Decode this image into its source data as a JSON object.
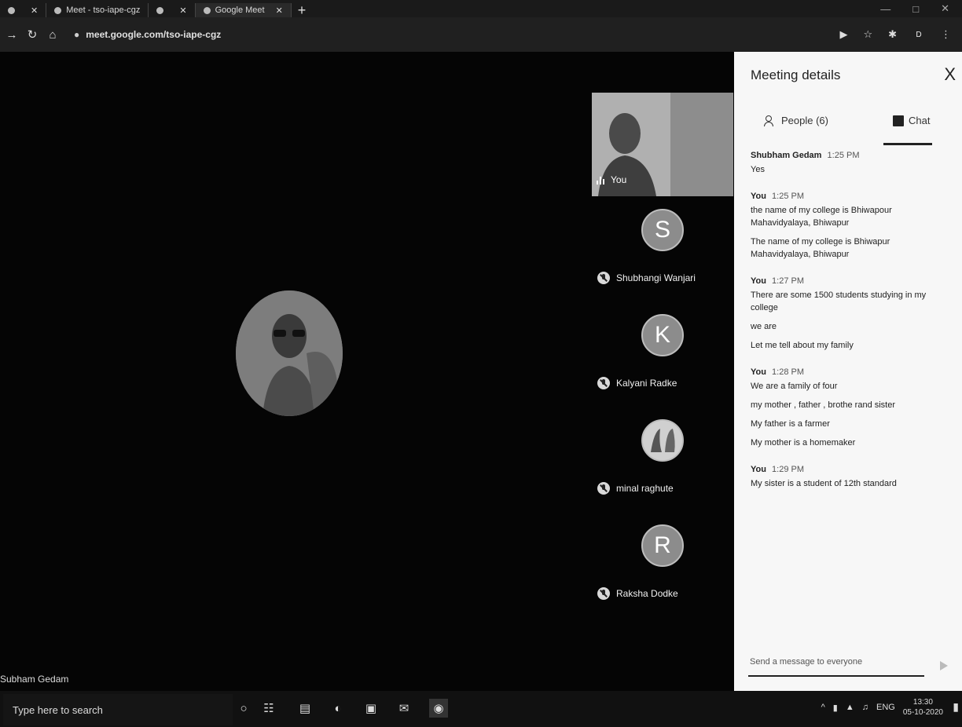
{
  "browser": {
    "tabs": [
      {
        "label": "",
        "active": false
      },
      {
        "label": "Meet - tso-iape-cgz",
        "active": false
      },
      {
        "label": "",
        "active": false
      },
      {
        "label": "Google Meet",
        "active": true
      }
    ],
    "new_tab": "+",
    "url": "meet.google.com/tso-iape-cgz",
    "profile_initial": "D"
  },
  "stage": {
    "presenter_name": "Subham Gedam",
    "self_tile_label": "You",
    "participants": [
      {
        "initial": "S",
        "name": "Shubhangi Wanjari",
        "muted": true,
        "photo": false
      },
      {
        "initial": "K",
        "name": "Kalyani Radke",
        "muted": true,
        "photo": false
      },
      {
        "initial": "",
        "name": "minal raghute",
        "muted": true,
        "photo": true
      },
      {
        "initial": "R",
        "name": "Raksha Dodke",
        "muted": true,
        "photo": false
      }
    ]
  },
  "panel": {
    "title": "Meeting details",
    "close": "X",
    "tab_people": "People (6)",
    "tab_chat": "Chat",
    "messages": [
      {
        "sender": "Shubham Gedam",
        "time": "1:25 PM",
        "lines": [
          "Yes"
        ]
      },
      {
        "sender": "You",
        "time": "1:25 PM",
        "lines": [
          "the name of my college is Bhiwapour Mahavidyalaya, Bhiwapur",
          "The name of my college is Bhiwapur Mahavidyalaya, Bhiwapur"
        ]
      },
      {
        "sender": "You",
        "time": "1:27 PM",
        "lines": [
          "There are some 1500 students studying in my college",
          "we are",
          "Let me tell about my family"
        ]
      },
      {
        "sender": "You",
        "time": "1:28 PM",
        "lines": [
          "We are  a family of four",
          "my mother , father , brothe rand sister",
          "My  father is a farmer",
          "My mother is a homemaker"
        ]
      },
      {
        "sender": "You",
        "time": "1:29 PM",
        "lines": [
          "My sister is a student of 12th standard"
        ]
      }
    ],
    "input_placeholder": "Send a message to everyone"
  },
  "taskbar": {
    "search_placeholder": "Type here to search",
    "tray_lang": "ENG",
    "time": "13:30",
    "date": "05-10-2020"
  }
}
